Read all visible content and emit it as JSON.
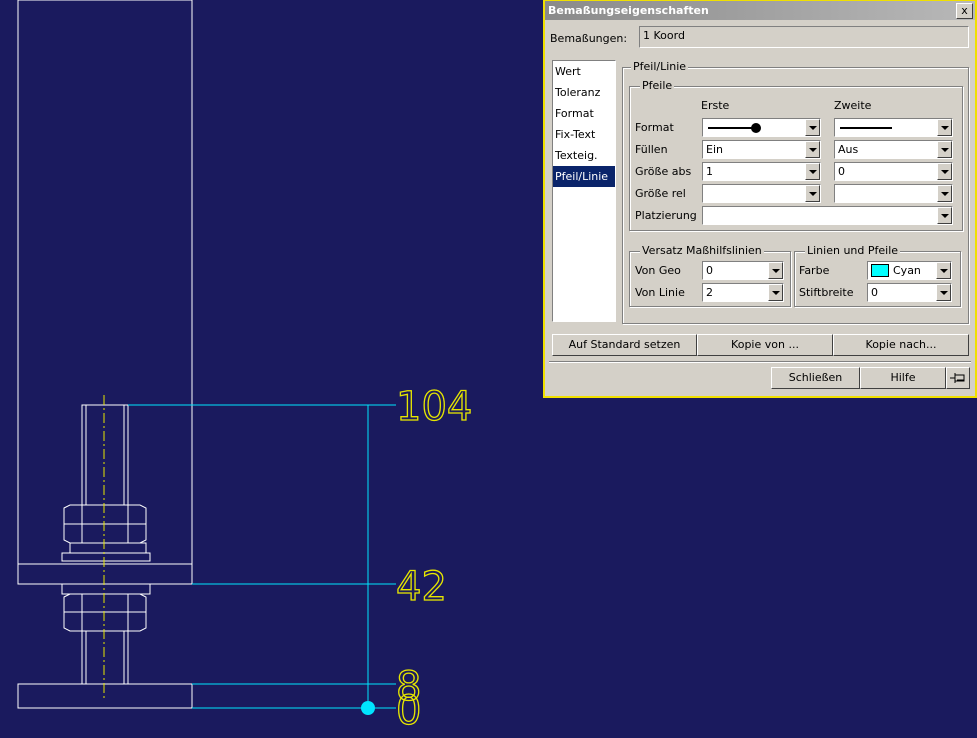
{
  "drawing": {
    "dimension_labels": [
      "104",
      "42",
      "8",
      "0"
    ],
    "line_color": "#ffffff",
    "dim_color": "#00e5ff",
    "text_color": "#e6e600"
  },
  "dialog": {
    "title": "Bemaßungseigenschaften",
    "close_glyph": "x",
    "dimensions_label": "Bemaßungen:",
    "dimensions_value": "1 Koord",
    "categories": [
      "Wert",
      "Toleranz",
      "Format",
      "Fix-Text",
      "Texteig.",
      "Pfeil/Linie"
    ],
    "selected_category": "Pfeil/Linie",
    "group_title": "Pfeil/Linie",
    "arrows": {
      "title": "Pfeile",
      "col_first": "Erste",
      "col_second": "Zweite",
      "rows": [
        {
          "label": "Format",
          "first": "",
          "second": ""
        },
        {
          "label": "Füllen",
          "first": "Ein",
          "second": "Aus"
        },
        {
          "label": "Größe abs",
          "first": "1",
          "second": "0"
        },
        {
          "label": "Größe rel",
          "first": "",
          "second": ""
        }
      ],
      "placement_label": "Platzierung",
      "placement_value": ""
    },
    "offset": {
      "title": "Versatz Maßhilfslinien",
      "geo_label": "Von Geo",
      "geo_value": "0",
      "line_label": "Von Linie",
      "line_value": "2"
    },
    "lines": {
      "title": "Linien und Pfeile",
      "color_label": "Farbe",
      "color_value": "Cyan",
      "color_swatch": "#00ffff",
      "pen_label": "Stiftbreite",
      "pen_value": "0"
    },
    "buttons": {
      "reset": "Auf Standard setzen",
      "copy_from": "Kopie von ...",
      "copy_to": "Kopie nach...",
      "close": "Schließen",
      "help": "Hilfe"
    }
  }
}
